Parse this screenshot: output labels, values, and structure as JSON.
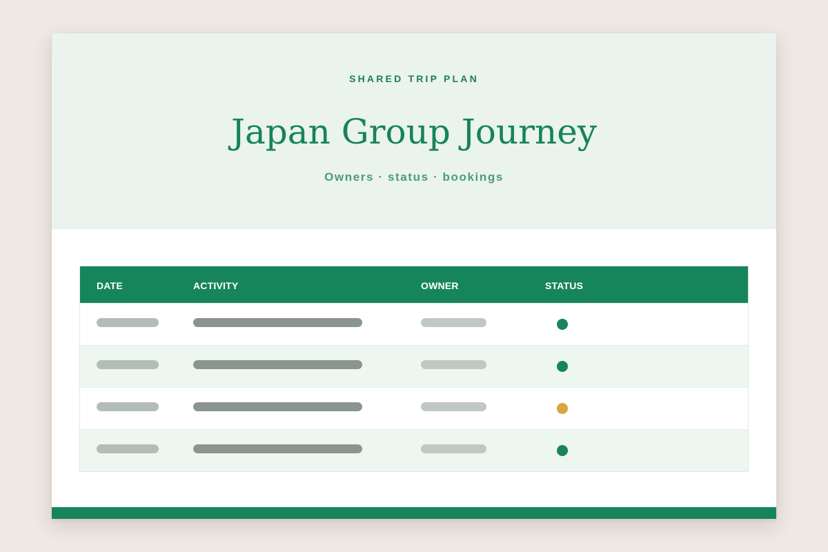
{
  "hero": {
    "eyebrow": "SHARED TRIP PLAN",
    "title": "Japan Group Journey",
    "subtitle": "Owners · status · bookings"
  },
  "table": {
    "columns": {
      "date": "DATE",
      "activity": "ACTIVITY",
      "owner": "OWNER",
      "status": "STATUS"
    },
    "rows": [
      {
        "status": "confirmed",
        "status_color": "#17855b"
      },
      {
        "status": "confirmed",
        "status_color": "#17855b"
      },
      {
        "status": "pending",
        "status_color": "#d9a441"
      },
      {
        "status": "confirmed",
        "status_color": "#17855b"
      }
    ]
  },
  "colors": {
    "accent": "#17855b",
    "background": "#efe8e3",
    "hero_background": "#eaf3ed",
    "pending": "#d9a441"
  }
}
